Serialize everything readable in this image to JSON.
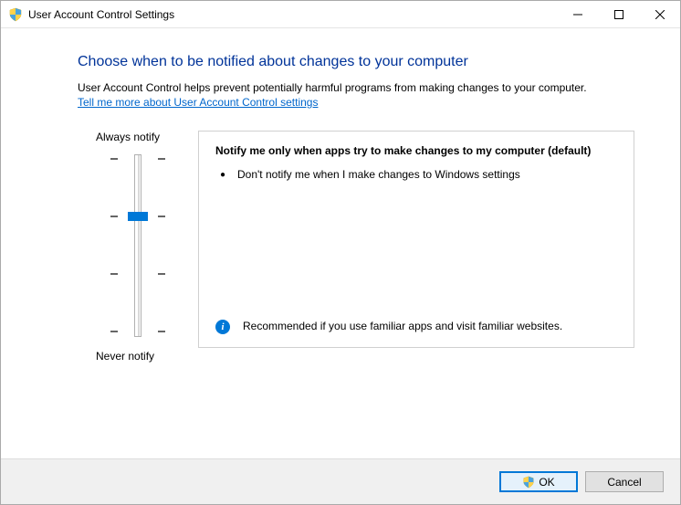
{
  "window": {
    "title": "User Account Control Settings"
  },
  "heading": "Choose when to be notified about changes to your computer",
  "subtext": "User Account Control helps prevent potentially harmful programs from making changes to your computer.",
  "link": "Tell me more about User Account Control settings",
  "slider": {
    "top_label": "Always notify",
    "bottom_label": "Never notify",
    "levels": 4,
    "selected_index": 1
  },
  "description": {
    "title": "Notify me only when apps try to make changes to my computer (default)",
    "bullets": [
      "Don't notify me when I make changes to Windows settings"
    ],
    "recommendation": "Recommended if you use familiar apps and visit familiar websites."
  },
  "buttons": {
    "ok": "OK",
    "cancel": "Cancel"
  }
}
